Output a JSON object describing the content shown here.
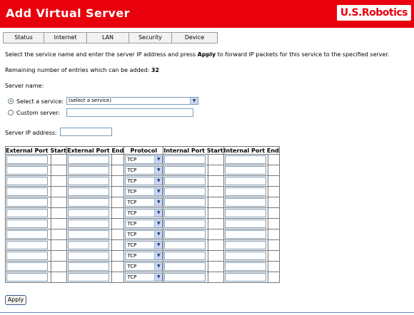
{
  "header": {
    "title": "Add Virtual Server",
    "logo": "U.S.Robotics"
  },
  "tabs": [
    {
      "label": "Status"
    },
    {
      "label": "Internet"
    },
    {
      "label": "LAN"
    },
    {
      "label": "Security"
    },
    {
      "label": "Device"
    }
  ],
  "intro": {
    "before": "Select the service name and enter the server IP address and press ",
    "bold": "Apply",
    "after": " to forward IP packets for this service to the specified server."
  },
  "remaining": {
    "label": "Remaining number of entries which can be added:",
    "value": "32"
  },
  "server_name_label": "Server name:",
  "select_service": {
    "label": "Select a service:",
    "value": "(select a service)"
  },
  "custom_server": {
    "label": "Custom server:",
    "value": ""
  },
  "server_ip_label": "Server IP address:",
  "table": {
    "headers": [
      "External Port Start",
      "External Port End",
      "Protocol",
      "Internal Port Start",
      "Internal Port End"
    ],
    "protocol": "TCP",
    "row_count": 12
  },
  "apply_label": "Apply",
  "colors": {
    "header_red": "#e8000c",
    "accent_blue": "#7f9db9"
  },
  "icons": [
    "dropdown-arrow-icon",
    "radio-selected-icon",
    "radio-unselected-icon"
  ]
}
